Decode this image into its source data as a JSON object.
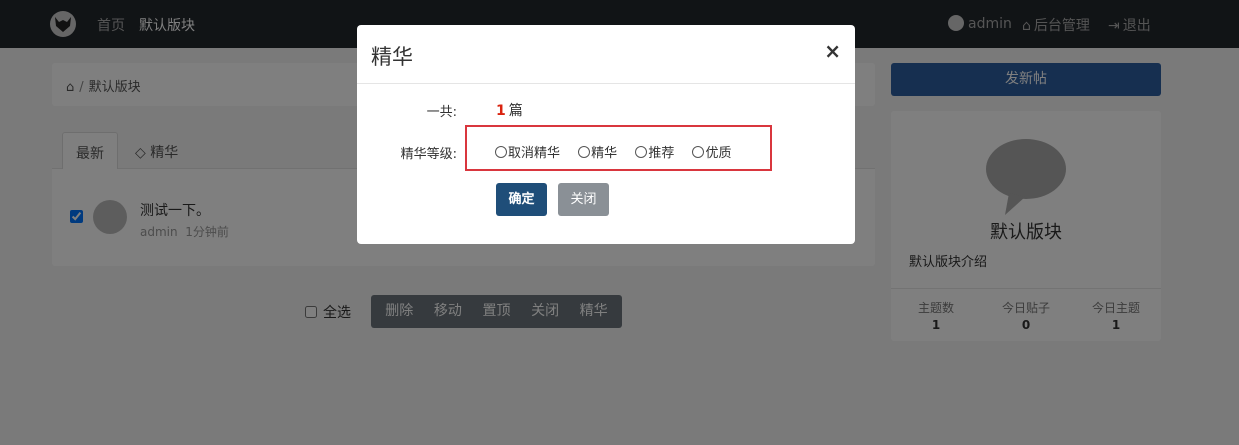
{
  "nav": {
    "home": "首页",
    "forum": "默认版块",
    "user": "admin",
    "admin": "后台管理",
    "logout": "退出"
  },
  "breadcrumb": {
    "current": "默认版块"
  },
  "tabs": {
    "latest": "最新",
    "digest": "精华"
  },
  "thread": {
    "title": "测试一下。",
    "author": "admin",
    "time": "1分钟前"
  },
  "bulk": {
    "select_all": "全选",
    "actions": [
      "删除",
      "移动",
      "置顶",
      "关闭",
      "精华"
    ]
  },
  "sidebar": {
    "post_button": "发新帖",
    "forum_name": "默认版块",
    "forum_desc": "默认版块介绍",
    "stats": [
      {
        "label": "主题数",
        "value": "1"
      },
      {
        "label": "今日贴子",
        "value": "0"
      },
      {
        "label": "今日主题",
        "value": "1"
      }
    ]
  },
  "modal": {
    "title": "精华",
    "close": "×",
    "total_label": "一共:",
    "total_value": "1",
    "total_unit": "篇",
    "level_label": "精华等级:",
    "options": [
      "取消精华",
      "精华",
      "推荐",
      "优质"
    ],
    "ok": "确定",
    "cancel": "关闭"
  },
  "colors": {
    "accent": "#2c5fa0",
    "highlight": "#d9363e",
    "count": "#d9230f"
  }
}
